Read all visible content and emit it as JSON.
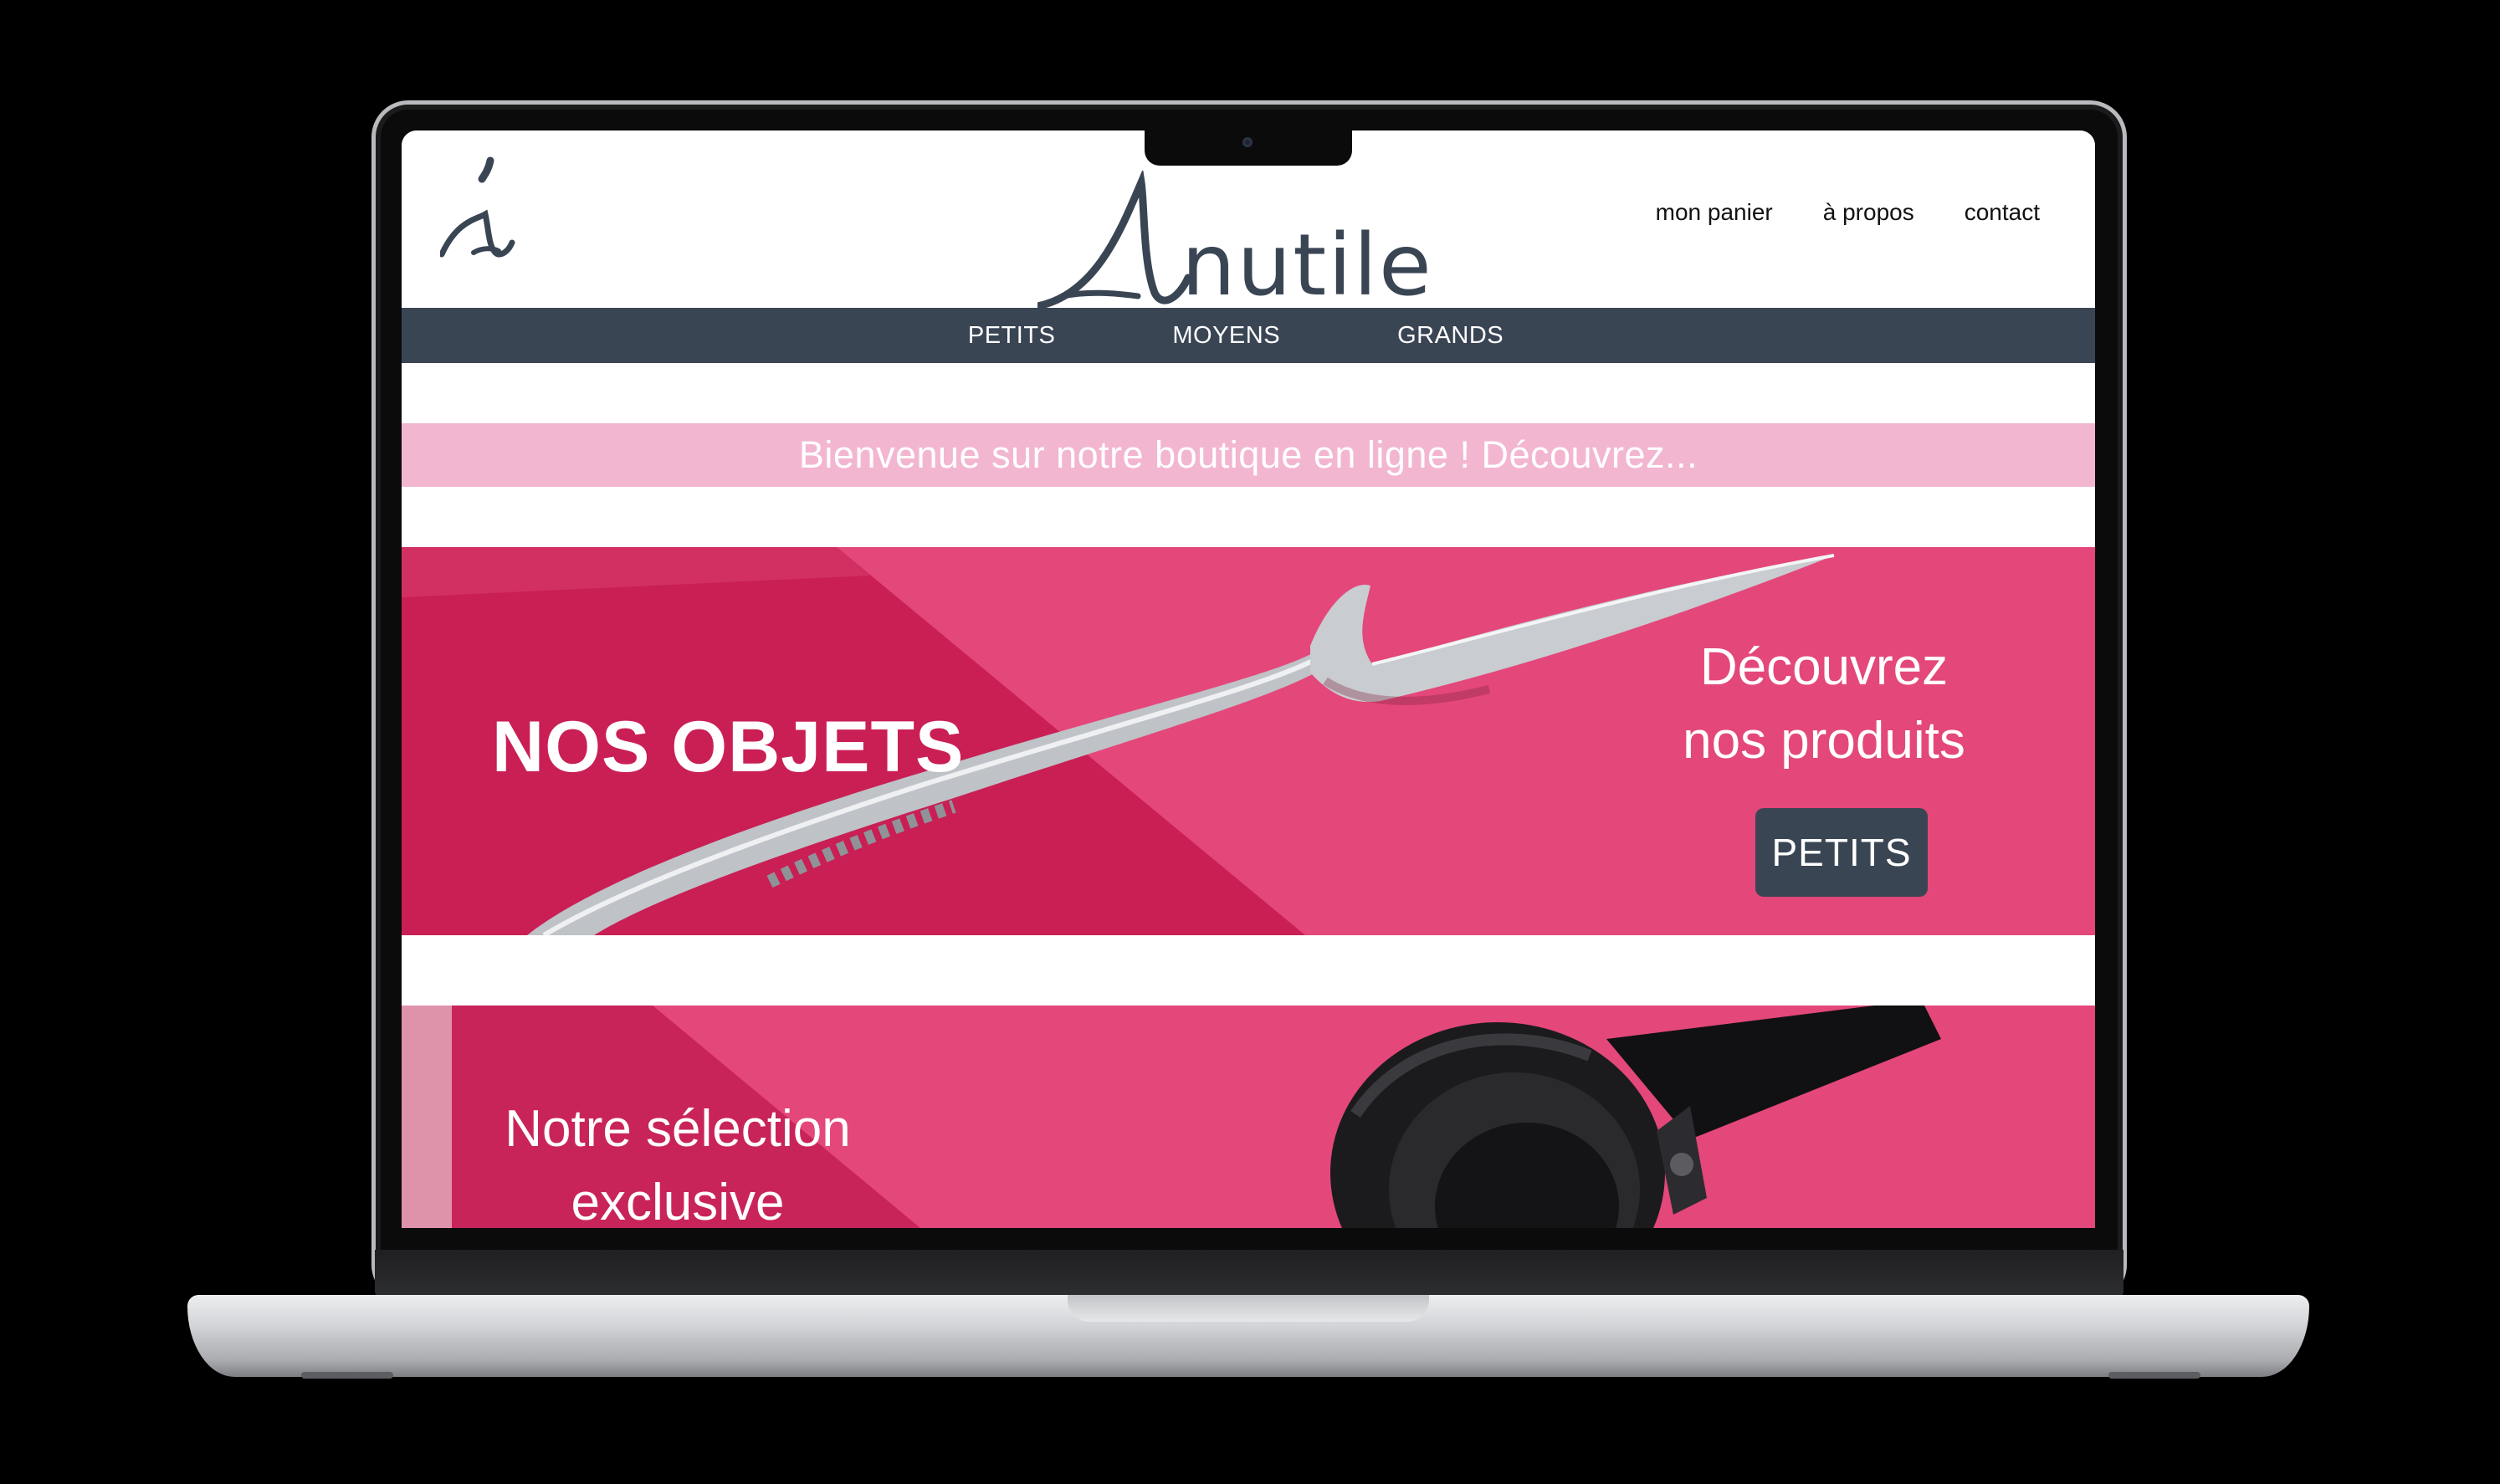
{
  "header": {
    "logo_alt": "i",
    "brand_name": "Inutile",
    "links": [
      "mon panier",
      "à propos",
      "contact"
    ]
  },
  "categories": [
    "PETITS",
    "MOYENS",
    "GRANDS"
  ],
  "welcome": {
    "text": "Bienvenue sur notre boutique en ligne ! Découvrez..."
  },
  "hero1": {
    "title": "NOS OBJETS",
    "subtitle_line1": "Découvrez",
    "subtitle_line2": "nos produits",
    "button": "PETITS"
  },
  "hero2": {
    "title_line1": "Notre sélection",
    "title_line2": "exclusive"
  },
  "colors": {
    "nav_bg": "#3a4554",
    "welcome_bg": "#f3b6d1",
    "hero_pink": "#e4477a",
    "hero_dark_pink": "#c91f55"
  },
  "icons": [
    "camera-icon",
    "fork-illustration",
    "headphones-illustration"
  ]
}
